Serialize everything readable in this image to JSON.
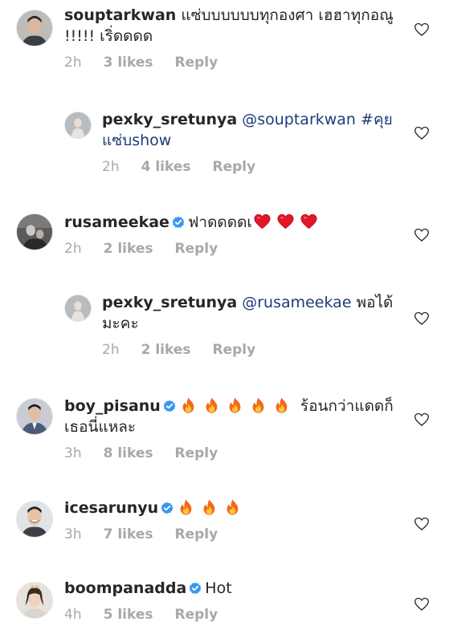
{
  "comments": [
    {
      "username": "souptarkwan",
      "text": "แซ่บบบบบบทุกองศา เฮฮาทุกอณู !!!!! เริ่ดดดด",
      "time": "2h",
      "likes": "3 likes",
      "reply": "Reply"
    },
    {
      "username": "pexky_sretunya",
      "mention": "@souptarkwan",
      "text": "#คุยแซ่บshow",
      "time": "2h",
      "likes": "4 likes",
      "reply": "Reply"
    },
    {
      "username": "rusameekae",
      "text": "ฟาดดดดเ",
      "time": "2h",
      "likes": "2 likes",
      "reply": "Reply"
    },
    {
      "username": "pexky_sretunya",
      "mention": "@rusameekae",
      "text": "พอได้ มะคะ",
      "time": "2h",
      "likes": "2 likes",
      "reply": "Reply"
    },
    {
      "username": "boy_pisanu",
      "text": "ร้อนกว่าแดดก็เธอนี่แหละ",
      "time": "3h",
      "likes": "8 likes",
      "reply": "Reply"
    },
    {
      "username": "icesarunyu",
      "text": "",
      "time": "3h",
      "likes": "7 likes",
      "reply": "Reply"
    },
    {
      "username": "boompanadda",
      "text": "Hot",
      "time": "4h",
      "likes": "5 likes",
      "reply": "Reply"
    }
  ],
  "colors": {
    "mention": "#1d3b7a",
    "meta": "#a8a8a8",
    "verified": "#3897f0"
  },
  "icons": [
    "heart-outline-icon",
    "verified-badge-icon",
    "red-heart-emoji",
    "fire-emoji"
  ]
}
